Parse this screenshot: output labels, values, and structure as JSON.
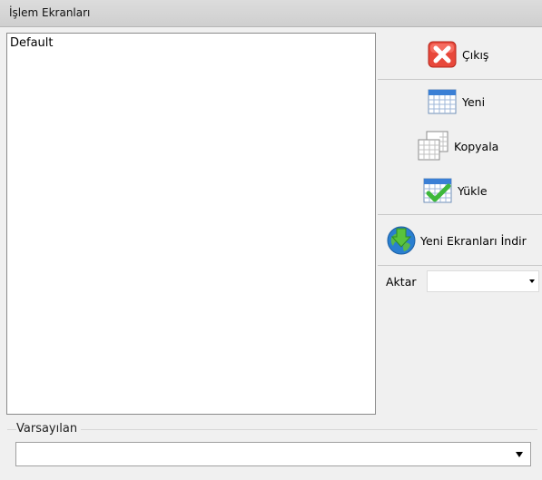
{
  "window": {
    "title": "İşlem Ekranları"
  },
  "list": {
    "items": [
      "Default"
    ]
  },
  "buttons": {
    "exit_label": "Çıkış",
    "new_label": "Yeni",
    "copy_label": "Kopyala",
    "load_label": "Yükle",
    "download_label": "Yeni Ekranları İndir"
  },
  "icons": {
    "exit": "close-x-icon",
    "new": "calendar-icon",
    "copy": "copy-pages-icon",
    "load": "calendar-check-icon",
    "download": "globe-download-icon"
  },
  "aktar": {
    "label": "Aktar",
    "value": ""
  },
  "default_group": {
    "label": "Varsayılan",
    "value": ""
  },
  "colors": {
    "exit_red": "#e8483b",
    "calendar_blue": "#3a7fd5",
    "check_green": "#3db83a",
    "globe_blue": "#2a7fd0"
  }
}
